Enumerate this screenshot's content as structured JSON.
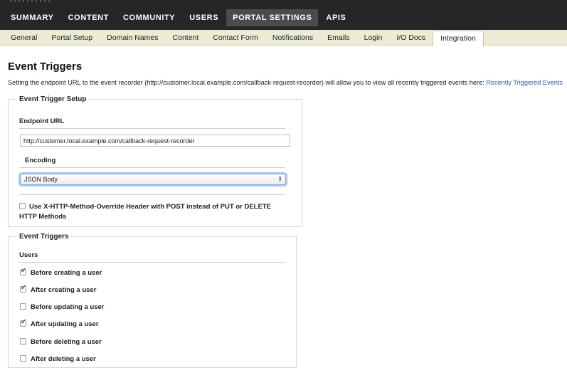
{
  "topnav": {
    "items": [
      {
        "label": "SUMMARY"
      },
      {
        "label": "CONTENT"
      },
      {
        "label": "COMMUNITY"
      },
      {
        "label": "USERS"
      },
      {
        "label": "PORTAL SETTINGS"
      },
      {
        "label": "APIS"
      }
    ],
    "active": "PORTAL SETTINGS"
  },
  "subnav": {
    "items": [
      {
        "label": "General"
      },
      {
        "label": "Portal Setup"
      },
      {
        "label": "Domain Names"
      },
      {
        "label": "Content"
      },
      {
        "label": "Contact Form"
      },
      {
        "label": "Notifications"
      },
      {
        "label": "Emails"
      },
      {
        "label": "Login"
      },
      {
        "label": "I/O Docs"
      },
      {
        "label": "Integration"
      }
    ],
    "active": "Integration"
  },
  "page": {
    "title": "Event Triggers",
    "intro_text": "Setting the endpoint URL to the event recorder (http://customer.local.example.com/callback-request-recorder) will allow you to view all recently triggered events here: ",
    "intro_link": "Recently Triggered Events"
  },
  "setup": {
    "legend": "Event Trigger Setup",
    "endpoint_label": "Endpoint URL",
    "endpoint_value": "http://customer.local.example.com/callback-request-recorder",
    "encoding_label": "Encoding",
    "encoding_value": "JSON Body",
    "override_label": "Use X-HTTP-Method-Override Header with POST instead of PUT or DELETE HTTP Methods",
    "override_checked": false
  },
  "triggers": {
    "legend": "Event Triggers",
    "group_label": "Users",
    "items": [
      {
        "label": "Before creating a user",
        "checked": true
      },
      {
        "label": "After creating a user",
        "checked": true
      },
      {
        "label": "Before updating a user",
        "checked": false
      },
      {
        "label": "After updating a user",
        "checked": true
      },
      {
        "label": "Before deleting a user",
        "checked": false
      },
      {
        "label": "After deleting a user",
        "checked": false
      }
    ]
  }
}
